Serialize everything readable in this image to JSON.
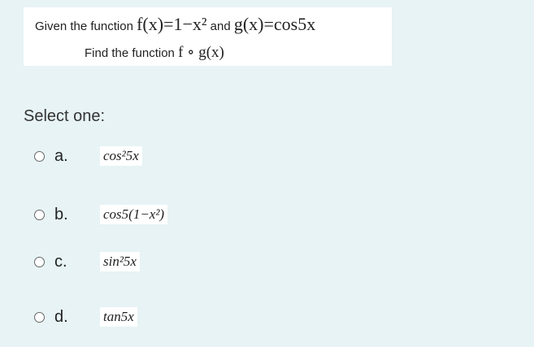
{
  "question": {
    "given_text": "Given the function",
    "f_expr": "f(x)=1−x²",
    "and_text": "and",
    "g_expr": "g(x)=cos5x",
    "find_text": "Find the function",
    "composition": "f ∘ g(x)"
  },
  "prompt": "Select one:",
  "options": [
    {
      "letter": "a.",
      "answer": "cos²5x"
    },
    {
      "letter": "b.",
      "answer": "cos5(1−x²)"
    },
    {
      "letter": "c.",
      "answer": "sin²5x"
    },
    {
      "letter": "d.",
      "answer": "tan5x"
    }
  ]
}
